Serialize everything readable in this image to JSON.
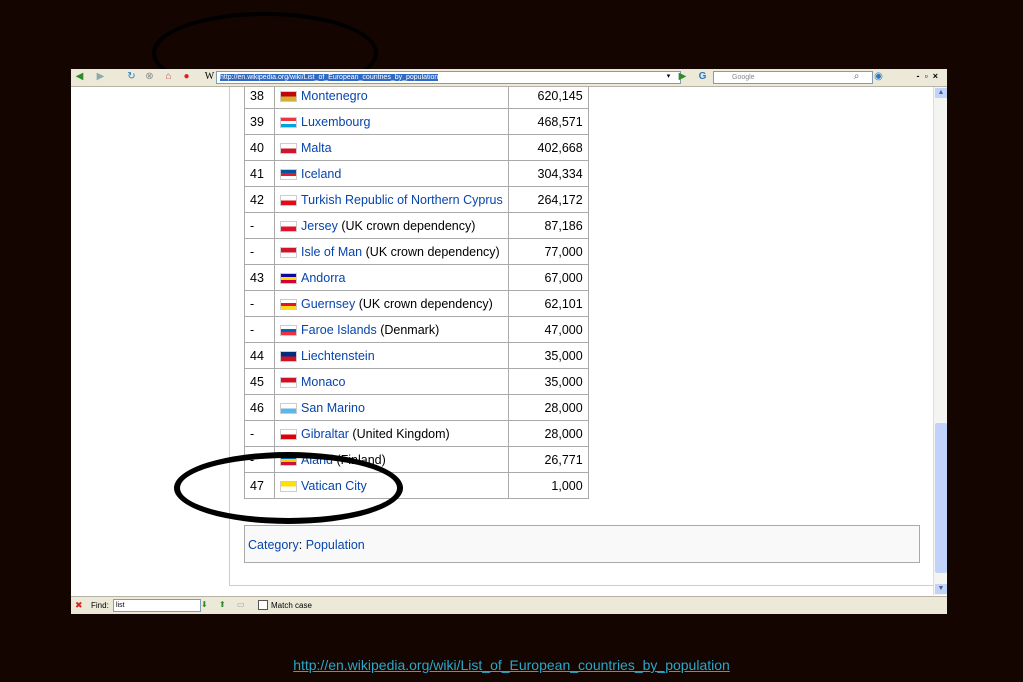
{
  "browser": {
    "url": "http://en.wikipedia.org/wiki/List_of_European_countries_by_population",
    "search_placeholder": "Google",
    "find_label": "Find:",
    "find_value": "list",
    "match_case_label": "Match case"
  },
  "rows": [
    {
      "rank": "38",
      "country": "Montenegro",
      "note": "",
      "population": "620,145",
      "flag": [
        "#c40308",
        "#d4af37"
      ]
    },
    {
      "rank": "39",
      "country": "Luxembourg",
      "note": "",
      "population": "468,571",
      "flag": [
        "#ef3340",
        "#ffffff",
        "#00a3e0"
      ]
    },
    {
      "rank": "40",
      "country": "Malta",
      "note": "",
      "population": "402,668",
      "flag": [
        "#ffffff",
        "#cf142b"
      ]
    },
    {
      "rank": "41",
      "country": "Iceland",
      "note": "",
      "population": "304,334",
      "flag": [
        "#02529c",
        "#dc1e35",
        "#ffffff"
      ]
    },
    {
      "rank": "42",
      "country": "Turkish Republic of Northern Cyprus",
      "note": "",
      "population": "264,172",
      "flag": [
        "#ffffff",
        "#e30a17"
      ]
    },
    {
      "rank": "-",
      "country": "Jersey",
      "note": "(UK crown dependency)",
      "population": "87,186",
      "flag": [
        "#ffffff",
        "#df112d"
      ]
    },
    {
      "rank": "-",
      "country": "Isle of Man",
      "note": "(UK crown dependency)",
      "population": "77,000",
      "flag": [
        "#cf142b",
        "#ffffff"
      ]
    },
    {
      "rank": "43",
      "country": "Andorra",
      "note": "",
      "population": "67,000",
      "flag": [
        "#10069f",
        "#fedd00",
        "#d50032"
      ]
    },
    {
      "rank": "-",
      "country": "Guernsey",
      "note": "(UK crown dependency)",
      "population": "62,101",
      "flag": [
        "#ffffff",
        "#e8112d",
        "#f9dd16"
      ]
    },
    {
      "rank": "-",
      "country": "Faroe Islands",
      "note": "(Denmark)",
      "population": "47,000",
      "flag": [
        "#ffffff",
        "#0065bd",
        "#ef303e"
      ]
    },
    {
      "rank": "44",
      "country": "Liechtenstein",
      "note": "",
      "population": "35,000",
      "flag": [
        "#002b7f",
        "#ce1126"
      ]
    },
    {
      "rank": "45",
      "country": "Monaco",
      "note": "",
      "population": "35,000",
      "flag": [
        "#ce1126",
        "#ffffff"
      ]
    },
    {
      "rank": "46",
      "country": "San Marino",
      "note": "",
      "population": "28,000",
      "flag": [
        "#ffffff",
        "#5eb6e4"
      ]
    },
    {
      "rank": "-",
      "country": "Gibraltar",
      "note": "(United Kingdom)",
      "population": "28,000",
      "flag": [
        "#ffffff",
        "#da000c"
      ]
    },
    {
      "rank": "-",
      "country": "Åland",
      "note": "(Finland)",
      "population": "26,771",
      "flag": [
        "#0064ae",
        "#ffce00",
        "#d21034"
      ]
    },
    {
      "rank": "47",
      "country": "Vatican City",
      "note": "",
      "population": "1,000",
      "flag": [
        "#ffe000",
        "#ffffff"
      ]
    }
  ],
  "category": {
    "label": "Category",
    "value": "Population"
  },
  "caption": "http://en.wikipedia.org/wiki/List_of_European_countries_by_population"
}
